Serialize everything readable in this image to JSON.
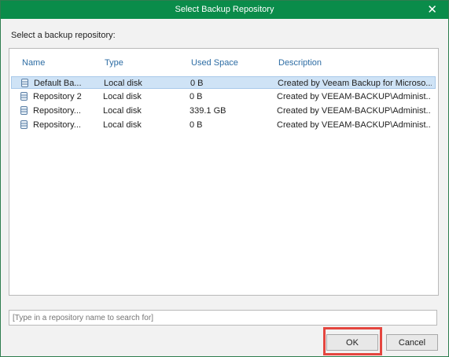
{
  "window": {
    "title": "Select Backup Repository"
  },
  "prompt": "Select a backup repository:",
  "table": {
    "columns": [
      "Name",
      "Type",
      "Used Space",
      "Description"
    ],
    "rows": [
      {
        "name": "Default Ba...",
        "type": "Local disk",
        "used": "0 B",
        "description": "Created by Veeam Backup for Microso...",
        "icon": "database-icon",
        "selected": true
      },
      {
        "name": "Repository 2",
        "type": "Local disk",
        "used": "0 B",
        "description": "Created by VEEAM-BACKUP\\Administ...",
        "icon": "database-icon",
        "selected": false
      },
      {
        "name": "Repository...",
        "type": "Local disk",
        "used": "339.1 GB",
        "description": "Created by VEEAM-BACKUP\\Administ...",
        "icon": "database-icon",
        "selected": false
      },
      {
        "name": "Repository...",
        "type": "Local disk",
        "used": "0 B",
        "description": "Created by VEEAM-BACKUP\\Administ...",
        "icon": "database-icon",
        "selected": false
      }
    ]
  },
  "search": {
    "placeholder": "[Type in a repository name to search for]"
  },
  "buttons": {
    "ok": "OK",
    "cancel": "Cancel"
  },
  "colors": {
    "titlebar": "#0a8c4a",
    "header_text": "#2e6da4",
    "selection": "#cfe3f6",
    "highlight_box": "#e4463f"
  },
  "icons": {
    "close": "close-icon"
  }
}
